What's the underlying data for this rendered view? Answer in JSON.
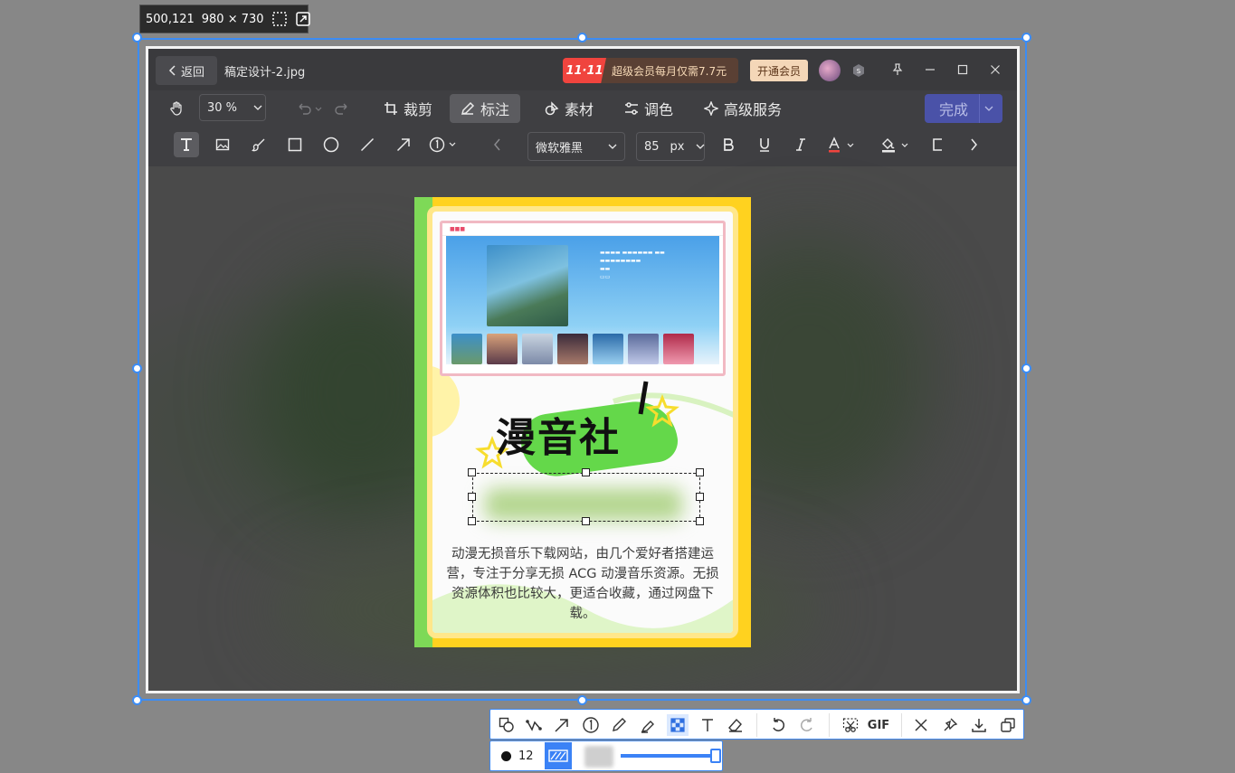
{
  "selection": {
    "position": "500,121",
    "size": "980 × 730"
  },
  "titlebar": {
    "back_label": "返回",
    "filename": "稿定设计-2.jpg",
    "promo_badge": "11·11",
    "promo_text": "超级会员每月仅需7.7元",
    "vip_button": "开通会员"
  },
  "toolbar": {
    "zoom": "30 %",
    "tabs": [
      {
        "label": "裁剪",
        "icon": "crop-icon"
      },
      {
        "label": "标注",
        "icon": "annotate-icon"
      },
      {
        "label": "素材",
        "icon": "material-icon"
      },
      {
        "label": "调色",
        "icon": "adjust-icon"
      },
      {
        "label": "高级服务",
        "icon": "advanced-icon"
      }
    ],
    "done_label": "完成"
  },
  "annotate_tools": {
    "font": "微软雅黑",
    "size": "85",
    "unit": "px"
  },
  "poster": {
    "title_art": "漫音社",
    "description": "动漫无损音乐下载网站，由几个爱好者搭建运营，专注于分享无损 ACG 动漫音乐资源。无损资源体积也比较大，更适合收藏，通过网盘下载。"
  },
  "capture_toolbar": {
    "tools": [
      "shape-icon",
      "polyline-icon",
      "arrow-icon",
      "number-icon",
      "pencil-icon",
      "marker-icon",
      "mosaic-icon",
      "text-icon",
      "eraser-icon",
      "undo-icon",
      "redo-icon",
      "scissors-icon",
      "gif-icon",
      "close-icon",
      "pin-icon",
      "download-icon",
      "copy-icon"
    ],
    "gif_label": "GIF",
    "brush_size": "12"
  },
  "colors": {
    "accent": "#3b8cf5",
    "done_button": "#4a52a8",
    "poster_yellow": "#ffd21f",
    "poster_green": "#7ed957"
  }
}
